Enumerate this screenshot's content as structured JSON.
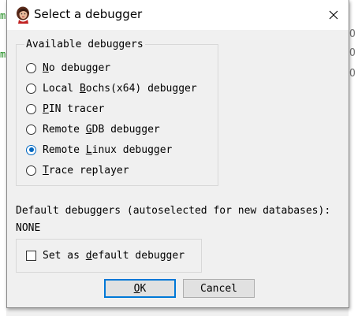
{
  "window": {
    "title": "Select a debugger"
  },
  "background": {
    "left_fragments": [
      "m",
      "m"
    ],
    "right_fragments": [
      "O",
      "O",
      "O"
    ]
  },
  "debuggers": {
    "legend": "Available debuggers",
    "options": [
      {
        "pre": "",
        "key": "N",
        "post": "o debugger",
        "checked": false
      },
      {
        "pre": "Local ",
        "key": "B",
        "post": "ochs(x64) debugger",
        "checked": false
      },
      {
        "pre": "",
        "key": "P",
        "post": "IN tracer",
        "checked": false
      },
      {
        "pre": "Remote ",
        "key": "G",
        "post": "DB debugger",
        "checked": false
      },
      {
        "pre": "Remote ",
        "key": "L",
        "post": "inux debugger",
        "checked": true
      },
      {
        "pre": "",
        "key": "T",
        "post": "race replayer",
        "checked": false
      }
    ]
  },
  "defaults": {
    "label": "Default debuggers (autoselected for new databases):",
    "value": "NONE",
    "checkbox_pre": "Set as ",
    "checkbox_key": "d",
    "checkbox_post": "efault debugger",
    "checkbox_checked": false
  },
  "buttons": {
    "ok_key": "O",
    "ok_post": "K",
    "cancel": "Cancel"
  },
  "colors": {
    "accent": "#0067c0",
    "title_bg": "#ffffff",
    "dialog_bg": "#f0f0f0"
  }
}
